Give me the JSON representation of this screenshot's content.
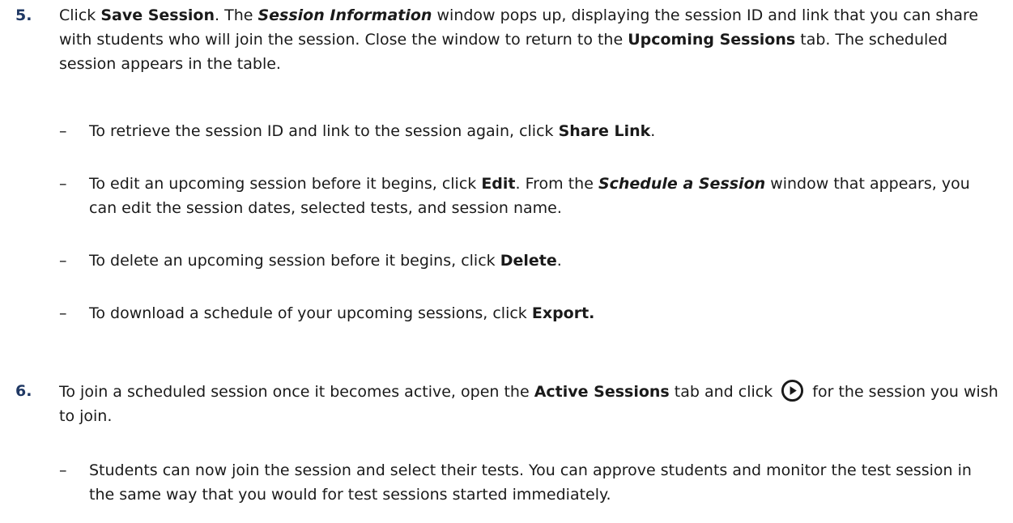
{
  "step5": {
    "number": "5.",
    "t1": "Click ",
    "save_session": "Save Session",
    "t2": ". The ",
    "session_information": "Session Information",
    "t3": " window pops up, displaying the session ID and link that you can share with students who will join the session. Close the window to return to the ",
    "upcoming_sessions": "Upcoming Sessions",
    "t4": " tab. The scheduled session appears in the table.",
    "bullets": [
      {
        "dash": "–",
        "pre": "To retrieve the session ID and link to the session again, click ",
        "bold": "Share Link",
        "post": "."
      },
      {
        "dash": "–",
        "pre": "To edit an upcoming session before it begins, click ",
        "bold": "Edit",
        "mid": ". From the ",
        "italic_bold": "Schedule a Session",
        "post": " window that appears, you can edit the session dates, selected tests, and session name."
      },
      {
        "dash": "–",
        "pre": "To delete an upcoming session before it begins, click ",
        "bold": "Delete",
        "post": "."
      },
      {
        "dash": "–",
        "pre": "To download a schedule of your upcoming sessions, click ",
        "bold": "Export."
      }
    ]
  },
  "step6": {
    "number": "6.",
    "t1": "To join a scheduled session once it becomes active, open the ",
    "active_sessions": "Active Sessions",
    "t2": " tab and click ",
    "icon": "play-circle-icon",
    "t3": " for the session you wish to join.",
    "bullets": [
      {
        "dash": "–",
        "text": "Students can now join the session and select their tests. You can approve students and monitor the test session in the same way that you would for test sessions started immediately."
      }
    ]
  }
}
